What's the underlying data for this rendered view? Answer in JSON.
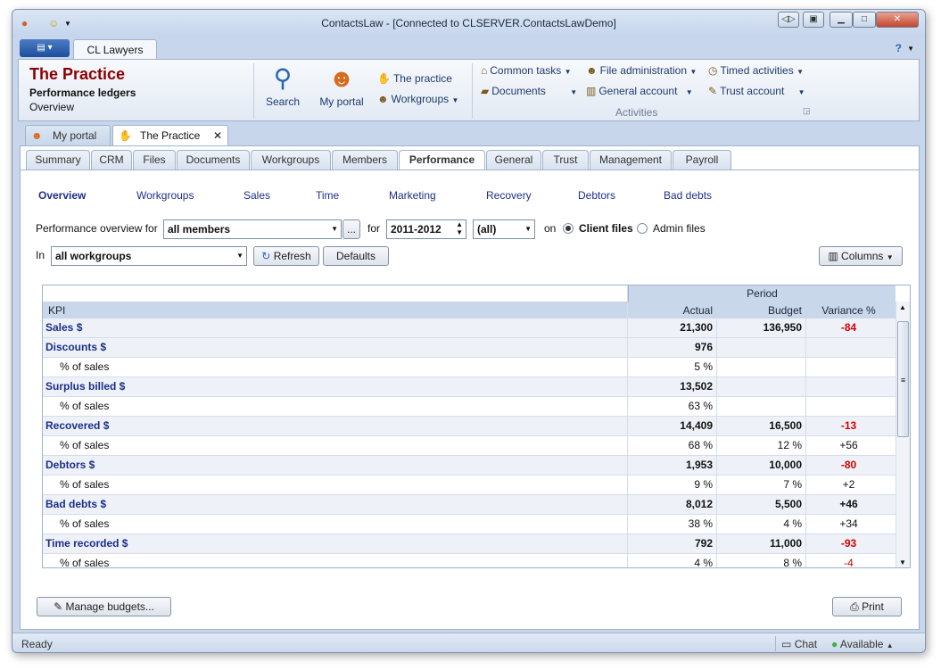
{
  "window": {
    "title": "ContactsLaw - [Connected to CLSERVER.ContactsLawDemo]"
  },
  "ribbon": {
    "tab": "CL Lawyers",
    "header": {
      "title": "The Practice",
      "subtitle": "Performance ledgers",
      "sub2": "Overview"
    },
    "search": "Search",
    "portal": "My portal",
    "practice": "The practice",
    "workgroups": "Workgroups",
    "common_tasks": "Common tasks",
    "documents": "Documents",
    "file_admin": "File administration",
    "general_account": "General account",
    "timed_activities": "Timed activities",
    "trust_account": "Trust account",
    "group_activities": "Activities"
  },
  "doc_tabs": {
    "portal": "My portal",
    "practice": "The Practice"
  },
  "page_tabs": [
    "Summary",
    "CRM",
    "Files",
    "Documents",
    "Workgroups",
    "Members",
    "Performance",
    "General",
    "Trust",
    "Management",
    "Payroll"
  ],
  "subnav": [
    "Overview",
    "Workgroups",
    "Sales",
    "Time",
    "Marketing",
    "Recovery",
    "Debtors",
    "Bad debts"
  ],
  "filters": {
    "overview_for_label": "Performance overview for",
    "member": "all members",
    "for_label": "for",
    "year": "2011-2012",
    "period": "(all)",
    "on_label": "on",
    "client_files": "Client files",
    "admin_files": "Admin files",
    "in_label": "In",
    "workgroup": "all workgroups",
    "refresh": "Refresh",
    "defaults": "Defaults",
    "columns": "Columns",
    "ellipsis": "..."
  },
  "grid": {
    "period_header": "Period",
    "kpi_header": "KPI",
    "actual_header": "Actual",
    "budget_header": "Budget",
    "variance_header": "Variance %",
    "rows": [
      {
        "kpi": "Sales $",
        "actual": "21,300",
        "budget": "136,950",
        "variance": "-84"
      },
      {
        "kpi": "Discounts $",
        "actual": "976",
        "budget": "",
        "variance": ""
      },
      {
        "kpi": "% of sales",
        "actual": "5 %",
        "budget": "",
        "variance": ""
      },
      {
        "kpi": "Surplus billed $",
        "actual": "13,502",
        "budget": "",
        "variance": ""
      },
      {
        "kpi": "% of sales",
        "actual": "63 %",
        "budget": "",
        "variance": ""
      },
      {
        "kpi": "Recovered $",
        "actual": "14,409",
        "budget": "16,500",
        "variance": "-13"
      },
      {
        "kpi": "% of sales",
        "actual": "68 %",
        "budget": "12 %",
        "variance": "+56"
      },
      {
        "kpi": "Debtors $",
        "actual": "1,953",
        "budget": "10,000",
        "variance": "-80"
      },
      {
        "kpi": "% of sales",
        "actual": "9 %",
        "budget": "7 %",
        "variance": "+2"
      },
      {
        "kpi": "Bad debts $",
        "actual": "8,012",
        "budget": "5,500",
        "variance": "+46"
      },
      {
        "kpi": "% of sales",
        "actual": "38 %",
        "budget": "4 %",
        "variance": "+34"
      },
      {
        "kpi": "Time recorded $",
        "actual": "792",
        "budget": "11,000",
        "variance": "-93"
      },
      {
        "kpi": "% of sales",
        "actual": "4 %",
        "budget": "8 %",
        "variance": "-4"
      }
    ]
  },
  "buttons": {
    "manage_budgets": "Manage budgets...",
    "print": "Print"
  },
  "status": {
    "ready": "Ready",
    "chat": "Chat",
    "available": "Available"
  },
  "colors": {
    "accent": "#1b2e8a",
    "negative": "#d40000",
    "title_red": "#8b0000"
  }
}
